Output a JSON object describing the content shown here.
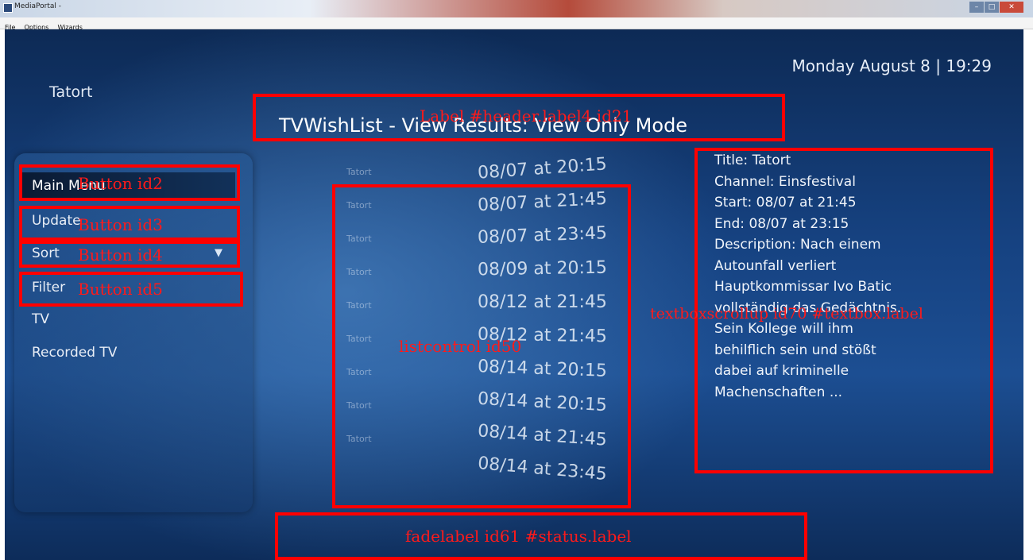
{
  "window": {
    "title": "MediaPortal -",
    "minimize": "–",
    "maximize": "□",
    "close": "✕"
  },
  "menubar": [
    "File",
    "Options",
    "Wizards"
  ],
  "clock": "Monday August 8 | 19:29",
  "category": "Tatort",
  "header": {
    "title": "TVWishList - View Results: View Only Mode"
  },
  "menu": [
    {
      "label": "Main Menu",
      "selected": true
    },
    {
      "label": "Update"
    },
    {
      "label": "Sort",
      "has_dropdown": true,
      "dropdown_icon": "▼"
    },
    {
      "label": "Filter"
    },
    {
      "label": "TV"
    },
    {
      "label": "Recorded TV"
    }
  ],
  "programs": [
    {
      "channel": "Tatort",
      "time": "08/07 at 20:15"
    },
    {
      "channel": "Tatort",
      "time": "08/07 at 21:45"
    },
    {
      "channel": "Tatort",
      "time": "08/07 at 23:45"
    },
    {
      "channel": "Tatort",
      "time": "08/09 at 20:15"
    },
    {
      "channel": "Tatort",
      "time": "08/12 at 21:45"
    },
    {
      "channel": "Tatort",
      "time": "08/12 at 21:45"
    },
    {
      "channel": "Tatort",
      "time": "08/14 at 20:15"
    },
    {
      "channel": "Tatort",
      "time": "08/14 at 20:15"
    },
    {
      "channel": "Tatort",
      "time": "08/14 at 21:45"
    },
    {
      "channel": "",
      "time": "08/14 at 23:45"
    }
  ],
  "details": [
    "Title: Tatort",
    "Channel: Einsfestival",
    "Start: 08/07 at 21:45",
    "End: 08/07 at 23:15",
    "Description: Nach einem",
    "Autounfall verliert",
    "Hauptkommissar Ivo Batic",
    "vollständig das Gedächtnis.",
    "Sein Kollege will ihm",
    "behilflich sein und stößt",
    "dabei auf kriminelle",
    "Machenschaften ..."
  ],
  "annotations": {
    "header": "Label #header.label4 id21",
    "button2": "Button id2",
    "button3": "Button id3",
    "button4": "Button id4",
    "button5": "Button id5",
    "listcontrol": "listcontrol id50",
    "textbox": "textboxscrollup id70 #textbox.label",
    "status": "fadelabel id61 #status.label"
  },
  "colors": {
    "annotation": "#ff0000",
    "background": "#164281"
  }
}
